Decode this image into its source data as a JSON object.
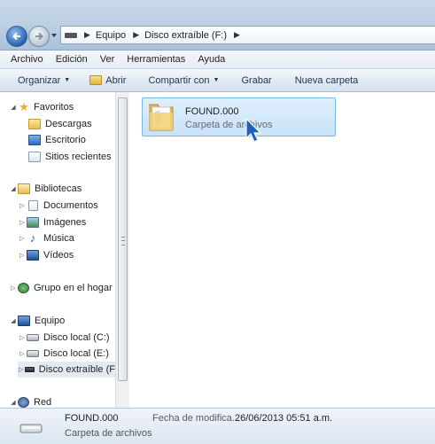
{
  "address": {
    "crumbs": [
      "Equipo",
      "Disco extraíble (F:)"
    ]
  },
  "menu": [
    "Archivo",
    "Edición",
    "Ver",
    "Herramientas",
    "Ayuda"
  ],
  "toolbar": {
    "organize": "Organizar",
    "open": "Abrir",
    "share": "Compartir con",
    "burn": "Grabar",
    "new_folder": "Nueva carpeta"
  },
  "nav": {
    "favorites": "Favoritos",
    "downloads": "Descargas",
    "desktop": "Escritorio",
    "recent": "Sitios recientes",
    "libraries": "Bibliotecas",
    "documents": "Documentos",
    "images": "Imágenes",
    "music": "Música",
    "videos": "Vídeos",
    "homegroup": "Grupo en el hogar",
    "computer": "Equipo",
    "disk_c": "Disco local (C:)",
    "disk_e": "Disco local (E:)",
    "removable": "Disco extraíble (F",
    "network": "Red"
  },
  "content": {
    "item_name": "FOUND.000",
    "item_type": "Carpeta de archivos"
  },
  "status": {
    "name": "FOUND.000",
    "type": "Carpeta de archivos",
    "date_label": "Fecha de modifica...",
    "date_value": "26/06/2013 05:51 a.m."
  }
}
